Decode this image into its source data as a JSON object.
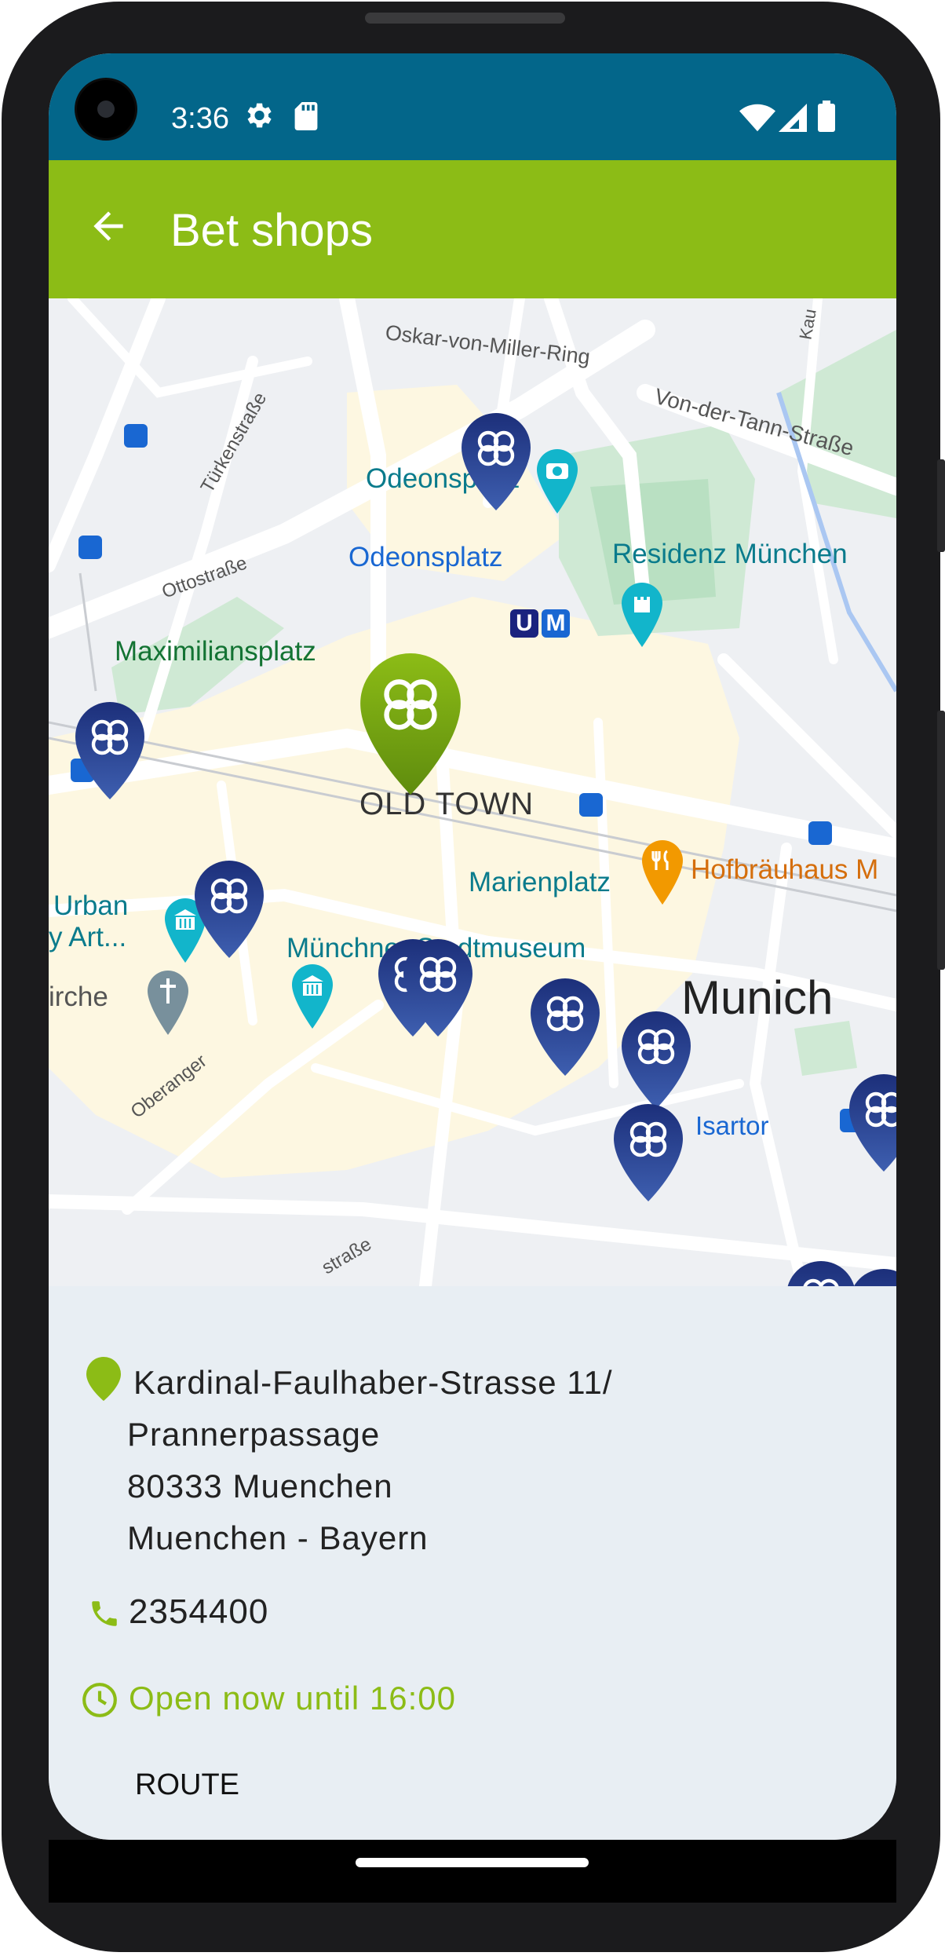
{
  "status_bar": {
    "time": "3:36",
    "icons": [
      "settings-gear-icon",
      "sd-card-icon",
      "wifi-icon",
      "signal-icon",
      "battery-icon"
    ]
  },
  "app_bar": {
    "title": "Bet shops",
    "back_icon": "arrow-back-icon"
  },
  "map": {
    "labels": {
      "oskar": "Oskar-von-Miller-Ring",
      "vondertann": "Von-der-Tann-Straße",
      "turken": "Türkenstraße",
      "ottostrasse": "Ottostraße",
      "odeonsplatz_poi": "Odeonsplatz",
      "odeonsplatz_station": "Odeonsplatz",
      "residenz": "Residenz München",
      "maximiliansplatz": "Maximiliansplatz",
      "oldtown": "OLD TOWN",
      "hofbrauhaus": "Hofbräuhaus M",
      "urban1": "Urban",
      "urban2": "y Art...",
      "marienplatz": "Marienplatz",
      "stadtmuseum": "Münchner Stadtmuseum",
      "kirche": "irche",
      "oberanger": "Oberanger",
      "munich": "Munich",
      "isartor": "Isartor",
      "strasse_bottom": "straße",
      "kau": "Kau"
    }
  },
  "details": {
    "address_lines": [
      "Kardinal-Faulhaber-Strasse 11/",
      "Prannerpassage",
      "80333 Muenchen",
      "Muenchen - Bayern"
    ],
    "phone": "2354400",
    "hours": "Open now until 16:00",
    "route_label": "ROUTE"
  },
  "colors": {
    "status_bar": "#03668a",
    "app_bar": "#8cbc16",
    "pin_blue": "#1f3a8a",
    "pin_green": "#7ca615",
    "panel_bg": "#e8eef3"
  }
}
